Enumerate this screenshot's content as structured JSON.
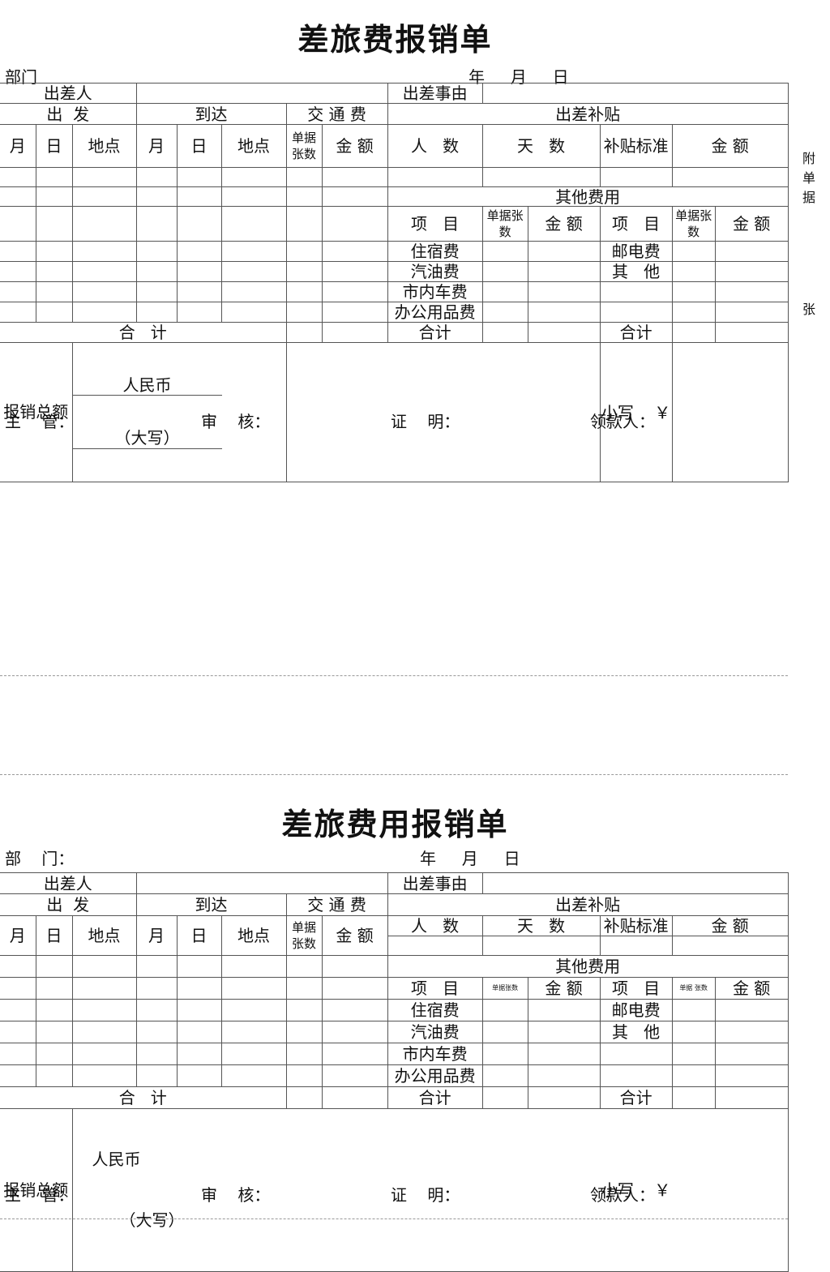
{
  "form1": {
    "title": "差旅费报销单",
    "dept_label": "部门",
    "date_label": "年     月     日",
    "traveler_label": "出差人",
    "reason_label": "出差事由",
    "depart_label": "出  发",
    "arrive_label": "到达",
    "transport_label": "交 通 费",
    "allowance_label": "出差补贴",
    "month": "月",
    "day": "日",
    "place": "地点",
    "receipts": "单据张数",
    "amount": "金 额",
    "persons": "人   数",
    "days": "天   数",
    "standard": "补贴标准",
    "other_label": "其他费用",
    "item": "项   目",
    "lodging": "住宿费",
    "gas": "汽油费",
    "local_car": "市内车费",
    "office": "办公用品费",
    "postal": "邮电费",
    "others": "其   他",
    "total": "合   计",
    "subtotal": "合计",
    "reimb_total": "报销总额",
    "rmb": "人民币",
    "capital": "（大写）",
    "lower": "小写    ￥"
  },
  "form2": {
    "title": "差旅费用报销单",
    "dept_label": "部    门：",
    "date_label": "年     月     日",
    "receipts_tiny": "单据张数",
    "receipts_tiny2": "单据  张数"
  },
  "footer": {
    "manager": "主    管：",
    "reviewer": "审    核：",
    "witness": "证    明：",
    "payee": "领款人："
  },
  "side_note": {
    "attach": "附单据",
    "sheets": "张"
  }
}
